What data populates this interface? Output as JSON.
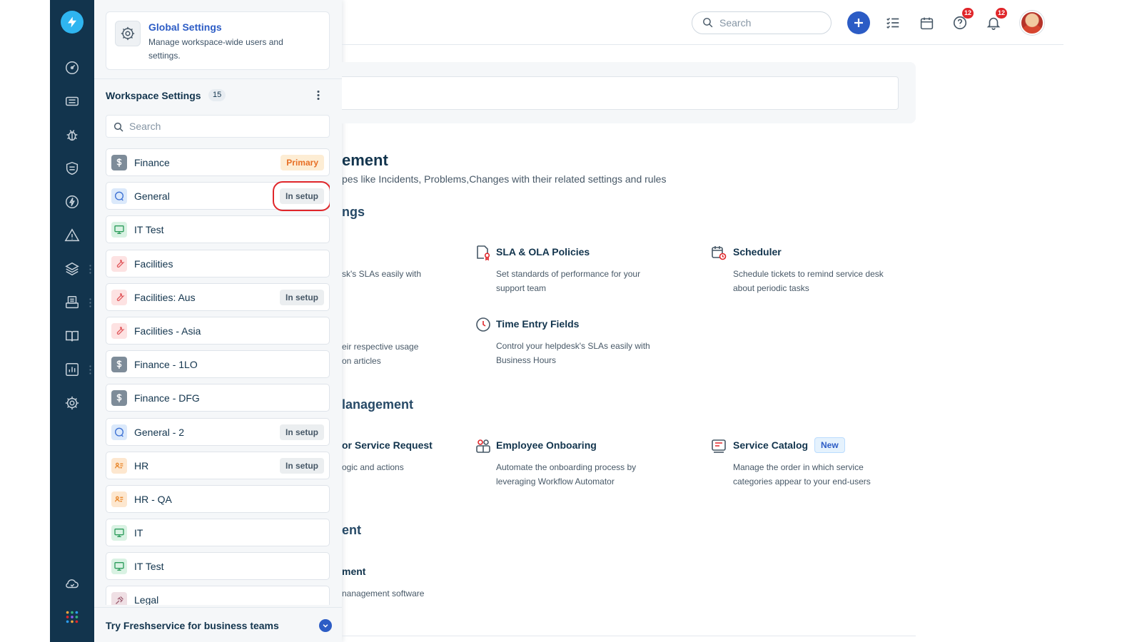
{
  "global_settings": {
    "title": "Global Settings",
    "description": "Manage workspace-wide users and settings."
  },
  "workspace": {
    "title": "Workspace Settings",
    "count": "15",
    "search_placeholder": "Search",
    "items": [
      {
        "name": "Finance",
        "badge": "Primary",
        "icon": "dollar-icon"
      },
      {
        "name": "General",
        "badge": "In setup",
        "icon": "chat-bubble-icon"
      },
      {
        "name": "IT Test",
        "badge": "",
        "icon": "monitor-icon"
      },
      {
        "name": "Facilities",
        "badge": "",
        "icon": "wrench-icon"
      },
      {
        "name": "Facilities: Aus",
        "badge": "In setup",
        "icon": "wrench-icon"
      },
      {
        "name": "Facilities - Asia",
        "badge": "",
        "icon": "wrench-icon"
      },
      {
        "name": "Finance - 1LO",
        "badge": "",
        "icon": "dollar-icon"
      },
      {
        "name": "Finance - DFG",
        "badge": "",
        "icon": "dollar-icon"
      },
      {
        "name": "General - 2",
        "badge": "In setup",
        "icon": "chat-bubble-icon"
      },
      {
        "name": "HR",
        "badge": "In setup",
        "icon": "id-card-icon"
      },
      {
        "name": "HR - QA",
        "badge": "",
        "icon": "id-card-icon"
      },
      {
        "name": "IT",
        "badge": "",
        "icon": "monitor-icon"
      },
      {
        "name": "IT Test",
        "badge": "",
        "icon": "monitor-icon"
      },
      {
        "name": "Legal",
        "badge": "",
        "icon": "gavel-icon"
      }
    ]
  },
  "footer": {
    "text": "Try Freshservice for business teams"
  },
  "header": {
    "search_placeholder": "Search",
    "help_count": "12",
    "notification_count": "12"
  },
  "main": {
    "section1": {
      "title": "ement",
      "description": "pes like  Incidents, Problems,Changes with their related settings and rules"
    },
    "subsection1": {
      "title": "ngs",
      "fragments": [
        {
          "desc": "sk's SLAs easily with"
        },
        {
          "desc_line1": "eir respective usage",
          "desc_line2": "on articles"
        }
      ],
      "cards": [
        {
          "title": "SLA & OLA Policies",
          "desc": "Set standards of performance for your support team",
          "icon": "sla-badge-icon"
        },
        {
          "title": "Scheduler",
          "desc": "Schedule tickets to remind service desk about periodic tasks",
          "icon": "calendar-clock-icon"
        },
        {
          "title": "Time Entry Fields",
          "desc": "Control your helpdesk's SLAs easily with Business Hours",
          "icon": "clock-icon"
        }
      ]
    },
    "subsection2": {
      "title": "lanagement",
      "fragment_title": "or Service Request",
      "fragment_desc": "ogic and actions",
      "cards": [
        {
          "title": "Employee Onboaring",
          "desc": "Automate the onboarding process by leveraging Workflow Automator",
          "icon": "people-icon"
        },
        {
          "title": "Service Catalog",
          "desc": "Manage the order in which service categories appear to your end-users",
          "icon": "catalog-icon",
          "badge": "New"
        }
      ]
    },
    "subsection3": {
      "title": "ent",
      "fragment_title": "ment",
      "fragment_desc": "nanagement software"
    }
  },
  "colors": {
    "rail": "#12344d",
    "accent": "#2c5cc5",
    "primary_badge": "#e86f25",
    "highlight": "#e0262a"
  }
}
